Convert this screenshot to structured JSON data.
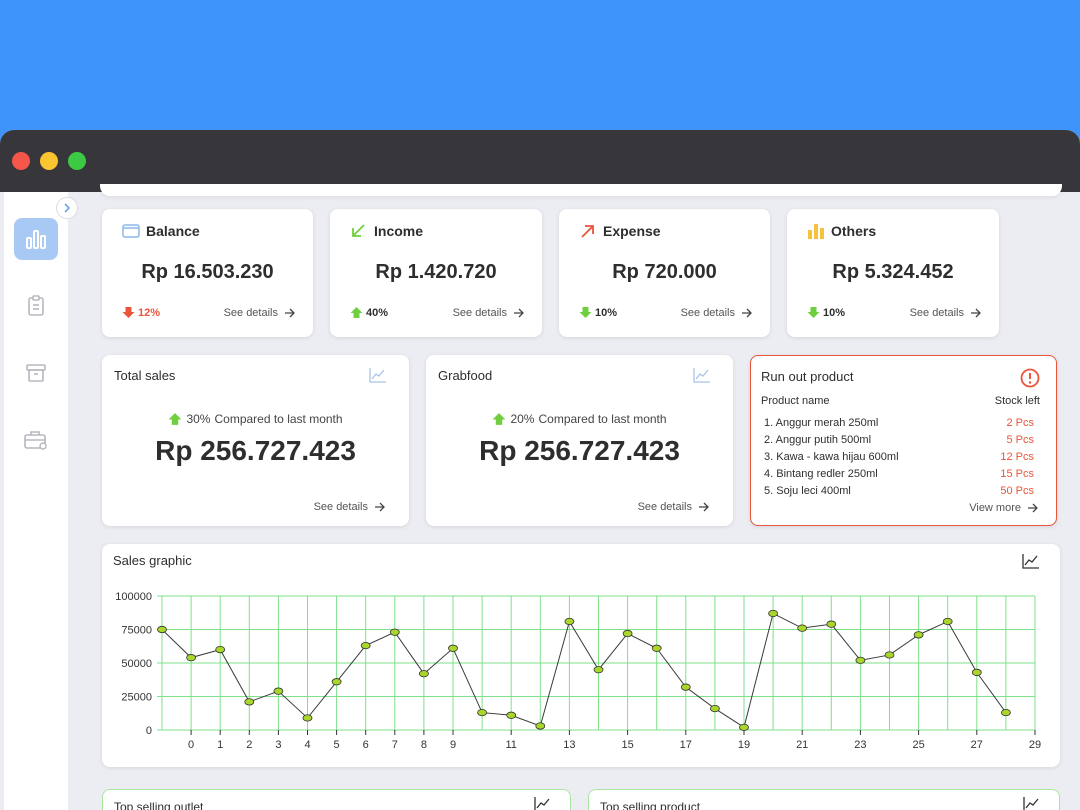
{
  "stats": [
    {
      "title": "Balance",
      "icon": "wallet-icon",
      "value": "Rp 16.503.230",
      "pct": "12%",
      "trend": "down",
      "trend_color": "#e9553a",
      "details": "See details"
    },
    {
      "title": "Income",
      "icon": "arrow-down-left-icon",
      "value": "Rp 1.420.720",
      "pct": "40%",
      "trend": "up",
      "trend_color": "#6fcf3f",
      "details": "See details"
    },
    {
      "title": "Expense",
      "icon": "arrow-up-right-icon",
      "value": "Rp 720.000",
      "pct": "10%",
      "trend": "down",
      "trend_color": "#6fcf3f",
      "details": "See details"
    },
    {
      "title": "Others",
      "icon": "bar-chart-icon",
      "value": "Rp 5.324.452",
      "pct": "10%",
      "trend": "down",
      "trend_color": "#6fcf3f",
      "details": "See details"
    }
  ],
  "total_sales": {
    "title": "Total sales",
    "pct": "30%",
    "compare": "Compared to last month",
    "value": "Rp 256.727.423",
    "details": "See details"
  },
  "grabfood": {
    "title": "Grabfood",
    "pct": "20%",
    "compare": "Compared to last month",
    "value": "Rp 256.727.423",
    "details": "See details"
  },
  "run_out": {
    "title": "Run out product",
    "col_product": "Product name",
    "col_stock": "Stock left",
    "items": [
      {
        "name": "1. Anggur merah 250ml",
        "stock": "2 Pcs"
      },
      {
        "name": "2. Anggur putih 500ml",
        "stock": "5 Pcs"
      },
      {
        "name": "3. Kawa - kawa hijau 600ml",
        "stock": "12 Pcs"
      },
      {
        "name": "4. Bintang redler 250ml",
        "stock": "15 Pcs"
      },
      {
        "name": "5. Soju leci 400ml",
        "stock": "50 Pcs"
      }
    ],
    "view_more": "View more"
  },
  "sales_graphic": {
    "title": "Sales graphic"
  },
  "chart_data": {
    "type": "line",
    "title": "Sales graphic",
    "xlabel": "",
    "ylabel": "",
    "x": [
      -1,
      0,
      1,
      2,
      3,
      4,
      5,
      6,
      7,
      8,
      9,
      10,
      11,
      12,
      13,
      14,
      15,
      16,
      17,
      18,
      19,
      20,
      21,
      22,
      23,
      24,
      25,
      26,
      27,
      28,
      29
    ],
    "values": [
      75000,
      54000,
      60000,
      21000,
      29000,
      9000,
      36000,
      63000,
      73000,
      42000,
      61000,
      13000,
      11000,
      3000,
      81000,
      45000,
      72000,
      61000,
      32000,
      16000,
      2000,
      87000,
      76000,
      79000,
      52000,
      56000,
      71000,
      81000,
      43000,
      13000
    ],
    "x_ticks": [
      0,
      1,
      2,
      3,
      4,
      5,
      6,
      7,
      8,
      9,
      11,
      13,
      15,
      17,
      19,
      21,
      23,
      25,
      27,
      29
    ],
    "y_ticks": [
      0,
      25000,
      50000,
      75000,
      100000
    ],
    "ylim": [
      0,
      100000
    ],
    "grid": true,
    "colors": {
      "line": "#3a3a3a",
      "marker": "#a8d62a",
      "grid": "#7fe08a"
    }
  },
  "bottom": {
    "outlet_title": "Top selling outlet",
    "product_title": "Top selling product"
  }
}
